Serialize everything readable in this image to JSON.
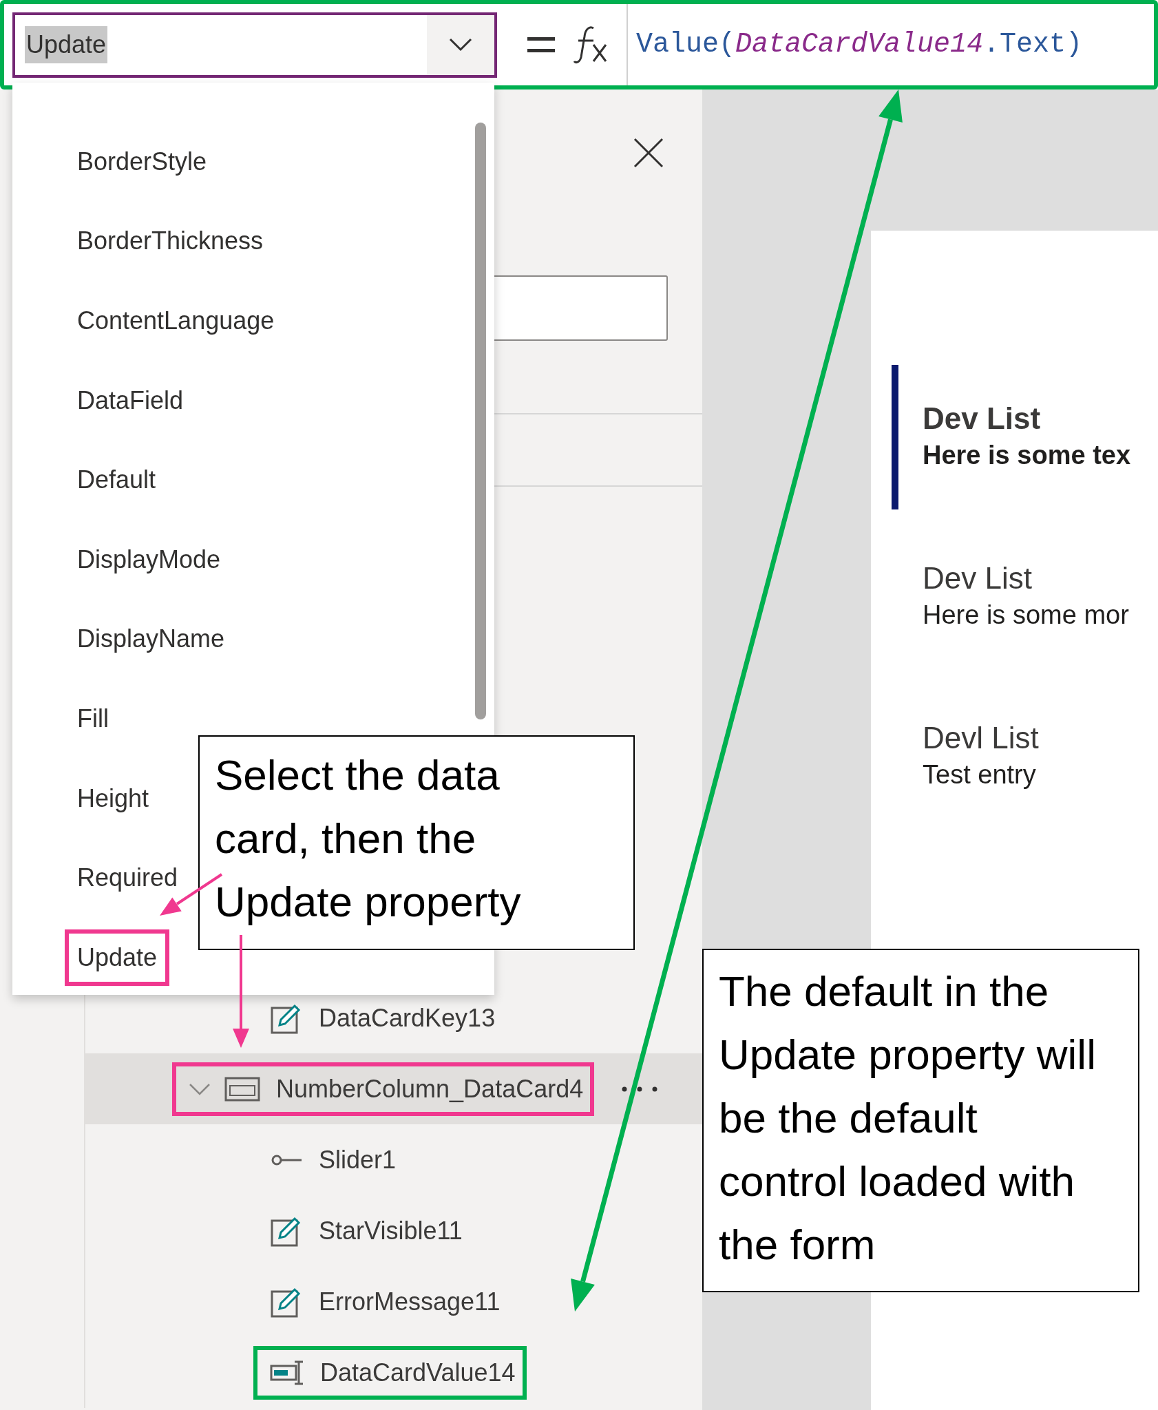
{
  "formula_bar": {
    "property": "Update",
    "color": "#00b050",
    "formula": [
      {
        "text": "Value(",
        "kind": "function"
      },
      {
        "text": "DataCardValue14",
        "kind": "reference"
      },
      {
        "text": ".Text)",
        "kind": "function"
      }
    ]
  },
  "property_menu": {
    "items": [
      {
        "label": "BorderStyle"
      },
      {
        "label": "BorderThickness"
      },
      {
        "label": "ContentLanguage"
      },
      {
        "label": "DataField"
      },
      {
        "label": "Default"
      },
      {
        "label": "DisplayMode"
      },
      {
        "label": "DisplayName"
      },
      {
        "label": "Fill"
      },
      {
        "label": "Height"
      },
      {
        "label": "Required"
      },
      {
        "label": "Update",
        "color": "#f0388f"
      }
    ]
  },
  "tree": {
    "items": [
      {
        "children": [
          {
            "label": "DataCardKey13",
            "kind": "edit"
          }
        ]
      },
      {
        "label": "NumberColumn_DataCard4",
        "kind": "card",
        "expanded": true,
        "selected": true,
        "color": "#f0388f",
        "children": [
          {
            "label": "Slider1",
            "kind": "slider"
          },
          {
            "label": "StarVisible11",
            "kind": "edit"
          },
          {
            "label": "ErrorMessage11",
            "kind": "edit"
          },
          {
            "label": "DataCardValue14",
            "kind": "input",
            "color": "#00b050"
          }
        ]
      }
    ]
  },
  "canvas": {
    "list_items": [
      {
        "title": "Dev List",
        "subtitle": "Here is some tex",
        "selected": true
      },
      {
        "title": "Dev List",
        "subtitle": "Here is some mor",
        "selected": false
      },
      {
        "title": "Devl List",
        "subtitle": "Test entry",
        "selected": false
      }
    ]
  },
  "callouts": [
    {
      "text": "Select the data card, then the Update property"
    },
    {
      "text": "The default in the Update property will be the default control loaded with the form"
    }
  ]
}
